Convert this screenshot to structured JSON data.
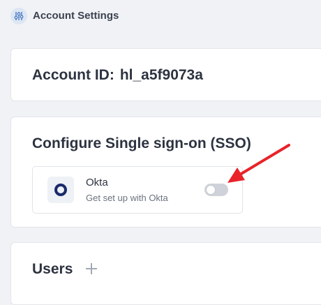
{
  "header": {
    "title": "Account Settings",
    "icon": "sliders-icon"
  },
  "account": {
    "label": "Account ID:",
    "value": "hl_a5f9073a"
  },
  "sso": {
    "heading": "Configure Single sign-on (SSO)",
    "provider": {
      "name": "Okta",
      "description": "Get set up with Okta",
      "icon": "okta-logo-icon",
      "enabled": false
    }
  },
  "users": {
    "heading": "Users",
    "add_icon": "plus-icon"
  },
  "colors": {
    "annotation": "#e8232a",
    "toggle_off": "#cfd3d9",
    "okta_brand": "#1a2b6b"
  }
}
